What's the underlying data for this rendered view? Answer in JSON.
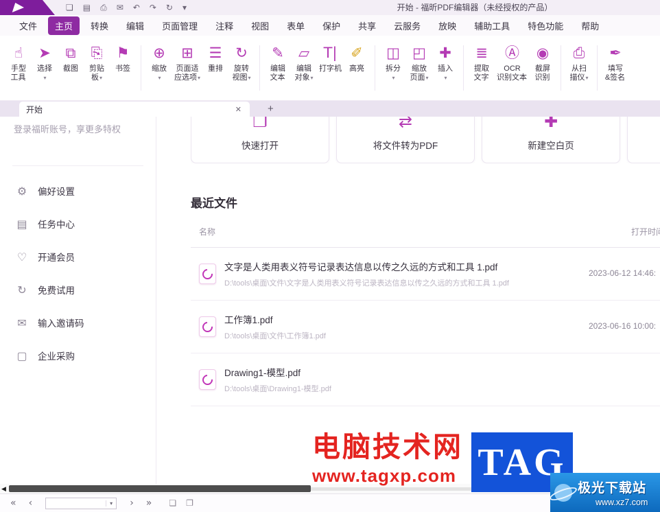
{
  "theme": {
    "accent": "#8e2ba2",
    "accent_dark": "#7e1d9c",
    "icon_magenta": "#b43bb4",
    "titlebar_bg": "#f3eef6",
    "watermark_red": "#e42420",
    "watermark_blue": "#1353d9",
    "badge_blue": "#1e86da"
  },
  "ui": {
    "caret": "▾",
    "close": "✕",
    "plus": "+"
  },
  "titlebar": {
    "title": "开始 - 福昕PDF编辑器（未经授权的产品）",
    "quick_icons": [
      {
        "name": "open-file",
        "glyph": "❏"
      },
      {
        "name": "save",
        "glyph": "▤"
      },
      {
        "name": "print",
        "glyph": "⎙"
      },
      {
        "name": "email",
        "glyph": "✉"
      },
      {
        "name": "undo",
        "glyph": "↶"
      },
      {
        "name": "redo",
        "glyph": "↷"
      },
      {
        "name": "refresh",
        "glyph": "↻"
      },
      {
        "name": "customize-toolbar",
        "glyph": "▾"
      }
    ]
  },
  "menubar": {
    "items": [
      {
        "name": "file",
        "label": "文件",
        "state": ""
      },
      {
        "name": "home",
        "label": "主页",
        "state": "active"
      },
      {
        "name": "convert",
        "label": "转换",
        "state": ""
      },
      {
        "name": "edit",
        "label": "编辑",
        "state": ""
      },
      {
        "name": "page-manage",
        "label": "页面管理",
        "state": ""
      },
      {
        "name": "comment",
        "label": "注释",
        "state": ""
      },
      {
        "name": "view",
        "label": "视图",
        "state": ""
      },
      {
        "name": "form",
        "label": "表单",
        "state": ""
      },
      {
        "name": "protect",
        "label": "保护",
        "state": ""
      },
      {
        "name": "share",
        "label": "共享",
        "state": ""
      },
      {
        "name": "cloud-service",
        "label": "云服务",
        "state": ""
      },
      {
        "name": "present",
        "label": "放映",
        "state": ""
      },
      {
        "name": "accessibility",
        "label": "辅助工具",
        "state": ""
      },
      {
        "name": "special-features",
        "label": "特色功能",
        "state": ""
      },
      {
        "name": "help",
        "label": "帮助",
        "state": ""
      }
    ]
  },
  "ribbon": {
    "buttons": [
      {
        "name": "hand-tool",
        "glyph": "☝",
        "lines": [
          "手型",
          "工具"
        ],
        "caret": ""
      },
      {
        "name": "select-tool",
        "glyph": "➤",
        "lines": [
          "选择"
        ],
        "caret": "▾"
      },
      {
        "name": "snapshot",
        "glyph": "⧉",
        "lines": [
          "截图"
        ],
        "caret": ""
      },
      {
        "name": "clipboard",
        "glyph": "⎘",
        "lines": [
          "剪贴",
          "板"
        ],
        "caret": "▾"
      },
      {
        "name": "bookmark",
        "glyph": "⚑",
        "lines": [
          "书签"
        ],
        "caret": "",
        "group_end": "group-end"
      },
      {
        "name": "zoom",
        "glyph": "⊕",
        "lines": [
          "缩放"
        ],
        "caret": "▾"
      },
      {
        "name": "page-fit-options",
        "glyph": "⊞",
        "lines": [
          "页面适",
          "应选项"
        ],
        "caret": "▾"
      },
      {
        "name": "reflow",
        "glyph": "☰",
        "lines": [
          "重排"
        ],
        "caret": ""
      },
      {
        "name": "rotate-view",
        "glyph": "↻",
        "lines": [
          "旋转",
          "视图"
        ],
        "caret": "▾",
        "group_end": "group-end"
      },
      {
        "name": "edit-text",
        "glyph": "✎",
        "lines": [
          "编辑",
          "文本"
        ],
        "caret": ""
      },
      {
        "name": "edit-object",
        "glyph": "▱",
        "lines": [
          "编辑",
          "对象"
        ],
        "caret": "▾"
      },
      {
        "name": "typewriter",
        "glyph": "T|",
        "lines": [
          "打字机"
        ],
        "caret": ""
      },
      {
        "name": "highlight",
        "glyph": "✐",
        "lines": [
          "高亮"
        ],
        "caret": "",
        "icon_color": "gold",
        "group_end": "group-end"
      },
      {
        "name": "split",
        "glyph": "◫",
        "lines": [
          "拆分"
        ],
        "caret": "▾"
      },
      {
        "name": "zoom-pages",
        "glyph": "◰",
        "lines": [
          "缩放",
          "页面"
        ],
        "caret": "▾"
      },
      {
        "name": "insert-page",
        "glyph": "✚",
        "lines": [
          "插入"
        ],
        "caret": "▾",
        "group_end": "group-end"
      },
      {
        "name": "extract-text",
        "glyph": "≣",
        "lines": [
          "提取",
          "文字"
        ],
        "caret": ""
      },
      {
        "name": "ocr-recognize-text",
        "glyph": "Ⓐ",
        "lines": [
          "OCR",
          "识别文本"
        ],
        "caret": ""
      },
      {
        "name": "screen-ocr",
        "glyph": "◉",
        "lines": [
          "截屏",
          "识别"
        ],
        "caret": "",
        "group_end": "group-end"
      },
      {
        "name": "from-scanner",
        "glyph": "⎙",
        "lines": [
          "从扫",
          "描仪"
        ],
        "caret": "▾",
        "group_end": "group-end"
      },
      {
        "name": "fill-and-sign",
        "glyph": "✒",
        "lines": [
          "填写",
          "&签名"
        ],
        "caret": ""
      }
    ]
  },
  "tabs": {
    "active_label": "开始"
  },
  "sidebar": {
    "promo": "登录福昕账号，享更多特权",
    "items": [
      {
        "name": "preferences",
        "glyph": "⚙",
        "label": "偏好设置"
      },
      {
        "name": "task-center",
        "glyph": "▤",
        "label": "任务中心"
      },
      {
        "name": "membership",
        "glyph": "♡",
        "label": "开通会员"
      },
      {
        "name": "free-trial",
        "glyph": "↻",
        "label": "免费试用"
      },
      {
        "name": "invite-code",
        "glyph": "✉",
        "label": "输入邀请码"
      },
      {
        "name": "enterprise-purchase",
        "glyph": "▢",
        "label": "企业采购"
      }
    ]
  },
  "main": {
    "cards": [
      {
        "name": "quick-open",
        "glyph": "❐",
        "label": "快速打开"
      },
      {
        "name": "convert-to-pdf",
        "glyph": "⇄",
        "label": "将文件转为PDF"
      },
      {
        "name": "new-blank-page",
        "glyph": "✚",
        "label": "新建空白页"
      },
      {
        "name": "clipped-card",
        "glyph": "",
        "label": ""
      }
    ],
    "recent": {
      "title": "最近文件",
      "columns": {
        "name": "名称",
        "time": "打开时间"
      },
      "files": [
        {
          "name": "文字是人类用表义符号记录表达信息以传之久远的方式和工具 1.pdf",
          "path": "D:\\tools\\桌面\\文件\\文字是人类用表义符号记录表达信息以传之久远的方式和工具 1.pdf",
          "time": "2023-06-12 14:46:"
        },
        {
          "name": "工作簿1.pdf",
          "path": "D:\\tools\\桌面\\文件\\工作簿1.pdf",
          "time": "2023-06-16 10:00:"
        },
        {
          "name": "Drawing1-模型.pdf",
          "path": "D:\\tools\\桌面\\Drawing1-模型.pdf",
          "time": ""
        }
      ]
    }
  },
  "watermark": {
    "site_name": "电脑技术网",
    "site_url": "www.tagxp.com",
    "tag_text": "TAG"
  },
  "download_badge": {
    "name": "极光下载站",
    "url": "www.xz7.com"
  },
  "scrollbar": {
    "left_arrow": "◀"
  },
  "statusbar": {
    "first": "«",
    "prev": "‹",
    "next": "›",
    "last": "»",
    "page_value": "",
    "view_icons": [
      {
        "name": "single-page-view",
        "glyph": "❏"
      },
      {
        "name": "facing-page-view",
        "glyph": "❐"
      }
    ]
  }
}
